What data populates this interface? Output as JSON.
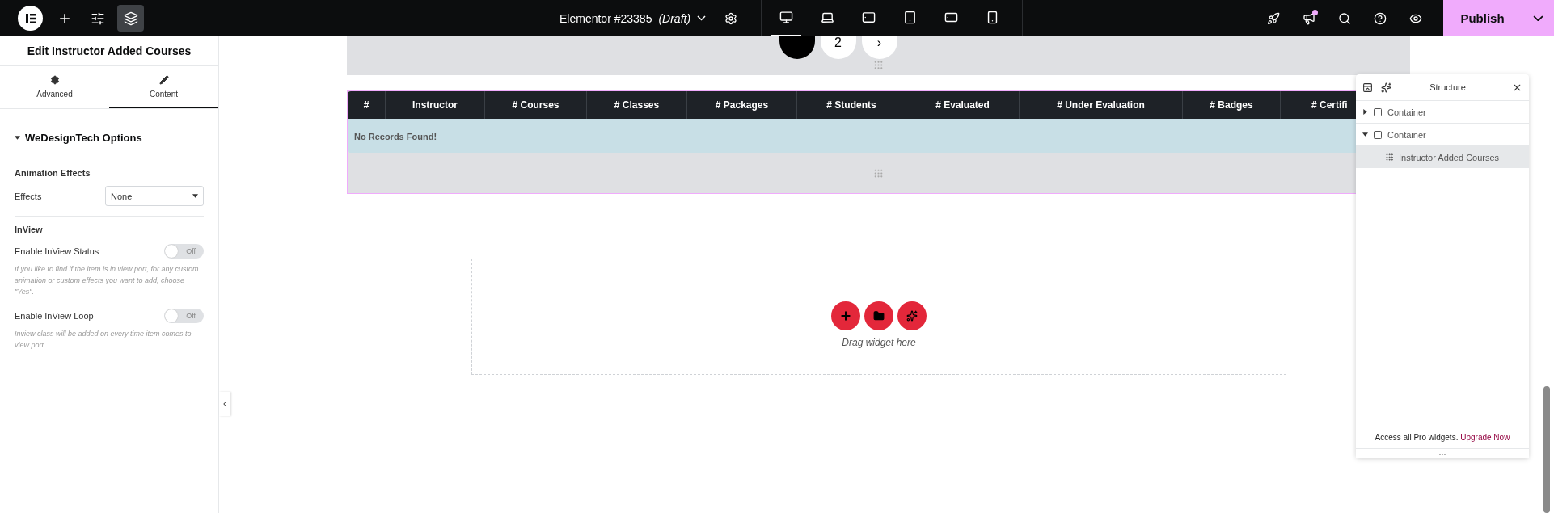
{
  "top_bar": {
    "tools": [
      {
        "kind": "add",
        "selected": false
      },
      {
        "kind": "settings",
        "selected": false
      },
      {
        "kind": "structure",
        "selected": true
      }
    ],
    "document": {
      "title": "Elementor #23385",
      "status": "(Draft)"
    },
    "devices": [
      {
        "kind": "desktop",
        "selected": true
      },
      {
        "kind": "laptop",
        "selected": false
      },
      {
        "kind": "tablet-landscape",
        "selected": false
      },
      {
        "kind": "tablet",
        "selected": false
      },
      {
        "kind": "mobile-landscape",
        "selected": false
      },
      {
        "kind": "mobile",
        "selected": false
      }
    ],
    "actions": [
      {
        "kind": "rocket",
        "badge": false
      },
      {
        "kind": "announcements",
        "badge": true
      },
      {
        "kind": "search",
        "badge": false
      },
      {
        "kind": "help",
        "badge": false
      },
      {
        "kind": "preview",
        "badge": false
      }
    ],
    "publish_button": "Publish"
  },
  "panel": {
    "title": "Edit Instructor Added Courses",
    "tabs": [
      {
        "label": "Advanced",
        "kind": "gear",
        "selected": false
      },
      {
        "label": "Content",
        "kind": "pencil",
        "selected": true
      }
    ],
    "section": {
      "title": "WeDesignTech Options",
      "expanded": true
    },
    "animation": {
      "heading": "Animation Effects",
      "label": "Effects",
      "value": "None"
    },
    "inview": {
      "heading": "InView",
      "toggles": [
        {
          "label": "Enable InView Status",
          "on": false,
          "state_label": "Off",
          "help": "If you like to find if the item is in view port, for any custom animation or custom effects you want to add, choose \"Yes\"."
        },
        {
          "label": "Enable InView Loop",
          "on": false,
          "state_label": "Off",
          "help": "Inview class will be added on every time item comes to view port."
        }
      ]
    }
  },
  "canvas": {
    "pagination": [
      {
        "selected": true
      },
      {
        "label": "2",
        "selected": false
      },
      {
        "label": "›",
        "selected": false
      }
    ],
    "table": {
      "columns": [
        "#",
        "Instructor",
        "# Courses",
        "# Classes",
        "# Packages",
        "# Students",
        "# Evaluated",
        "# Under Evaluation",
        "# Badges",
        "# Certifi"
      ],
      "empty_message": "No Records Found!"
    },
    "drop_zone": {
      "hint": "Drag widget here"
    }
  },
  "structure": {
    "title": "Structure",
    "items": [
      {
        "label": "Container",
        "kind": "container",
        "expanded": false,
        "selected": false
      },
      {
        "label": "Container",
        "kind": "container",
        "expanded": true,
        "selected": false,
        "children": [
          {
            "label": "Instructor Added Courses",
            "kind": "widget",
            "selected": true
          }
        ]
      }
    ],
    "footer": {
      "text": "Access all Pro widgets.",
      "link": "Upgrade Now",
      "more": "···"
    }
  }
}
